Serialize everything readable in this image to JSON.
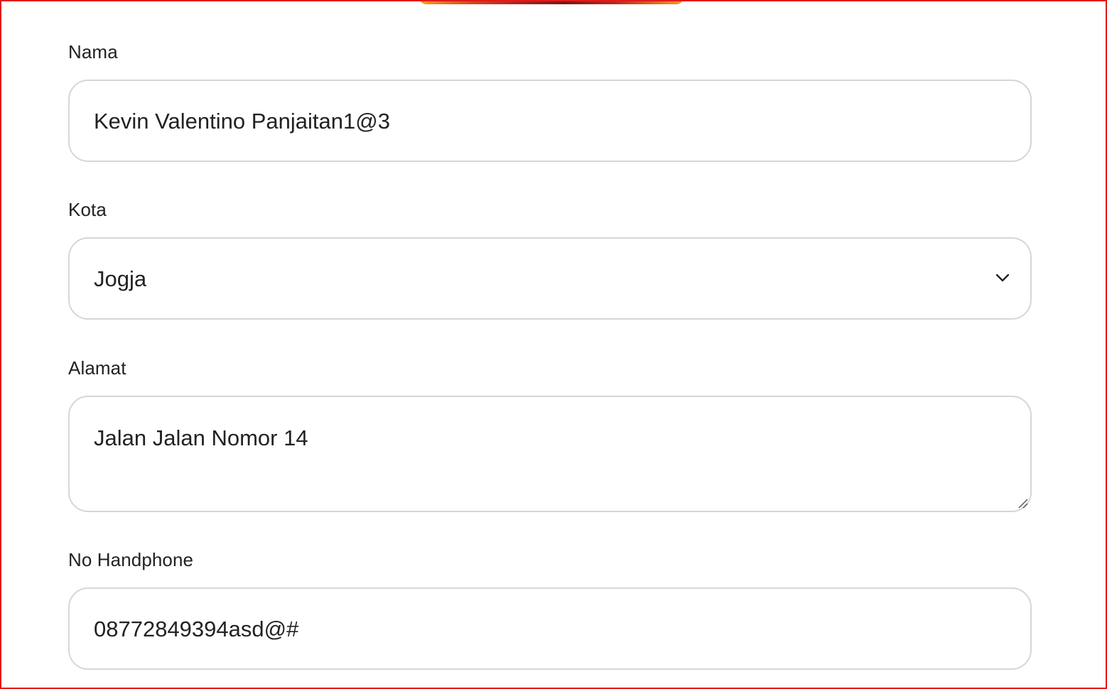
{
  "form": {
    "nama": {
      "label": "Nama",
      "value": "Kevin Valentino Panjaitan1@3"
    },
    "kota": {
      "label": "Kota",
      "selected": "Jogja",
      "icon": "chevron-down-icon"
    },
    "alamat": {
      "label": "Alamat",
      "value": "Jalan Jalan Nomor 14",
      "icon": "resize-handle-icon"
    },
    "no_handphone": {
      "label": "No Handphone",
      "value": "08772849394asd@#"
    }
  },
  "colors": {
    "frame_border": "#e01b1b",
    "field_border": "#d6d6d6",
    "text": "#222222"
  }
}
